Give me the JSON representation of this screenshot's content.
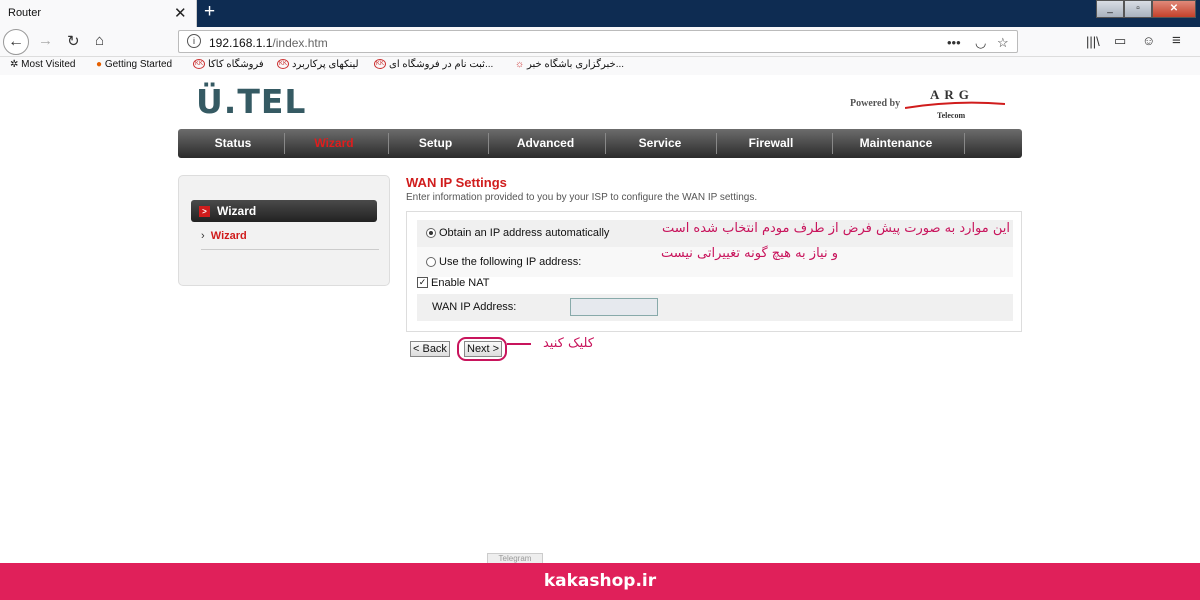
{
  "browser": {
    "tab_title": "Router",
    "tab_close": "✕",
    "new_tab": "+",
    "url_host": "192.168.1.1",
    "url_path": "/index.htm",
    "url_dots": "•••",
    "bookmarks": [
      {
        "label": "Most Visited"
      },
      {
        "label": "Getting Started"
      },
      {
        "label": "فروشگاه کاکا"
      },
      {
        "label": "لینکهای پرکاربرد"
      },
      {
        "label": "ثبت نام در فروشگاه ای..."
      },
      {
        "label": "خبرگزاری باشگاه خبر..."
      }
    ],
    "window_buttons": {
      "minimize": "_",
      "maximize": "▫",
      "close": "✕"
    }
  },
  "router": {
    "logo": "Ü.TEL",
    "powered_by": "Powered by",
    "brand": "ARG",
    "brand_sub": "Telecom",
    "menu": [
      {
        "label": "Status",
        "active": false
      },
      {
        "label": "Wizard",
        "active": true
      },
      {
        "label": "Setup",
        "active": false
      },
      {
        "label": "Advanced",
        "active": false
      },
      {
        "label": "Service",
        "active": false
      },
      {
        "label": "Firewall",
        "active": false
      },
      {
        "label": "Maintenance",
        "active": false
      }
    ],
    "sidebar": {
      "header": "Wizard",
      "link": "Wizard"
    },
    "content": {
      "title": "WAN IP Settings",
      "description": "Enter information provided to you by your ISP to configure the WAN IP settings.",
      "option_auto": "Obtain an IP address automatically",
      "option_manual": "Use the following IP address:",
      "selected_option": "auto",
      "enable_nat_label": "Enable NAT",
      "enable_nat_checked": true,
      "wan_ip_label": "WAN IP Address:",
      "wan_ip_value": ""
    },
    "buttons": {
      "back": "< Back",
      "next": "Next >"
    }
  },
  "annotations": {
    "line1": "این موارد به صورت پیش فرض از طرف مودم انتخاب شده است",
    "line2": "و نیاز به هیچ گونه تغییراتی نیست",
    "click": "کلیک کنید",
    "color": "#c8145c"
  },
  "footer": {
    "telegram_tab": "Telegram",
    "site": "kakashop.ir",
    "color": "#e0205a"
  }
}
